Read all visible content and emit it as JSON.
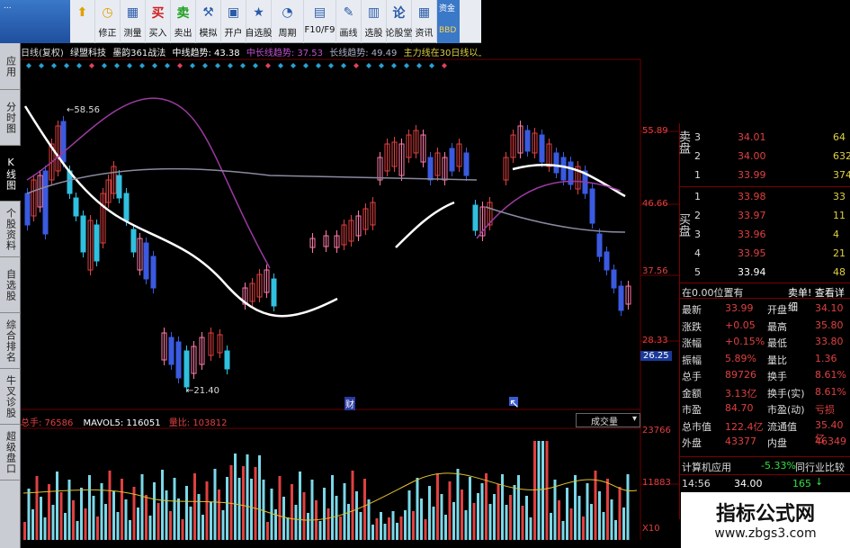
{
  "toolbar": {
    "logo_text": "...",
    "buttons": [
      {
        "label": "",
        "icon": "up-arrow-icon"
      },
      {
        "label": "修正",
        "icon": "clock-icon"
      },
      {
        "label": "测量",
        "icon": "gauge-icon"
      },
      {
        "label": "买入",
        "icon": "buy-icon"
      },
      {
        "label": "卖出",
        "icon": "sell-icon"
      },
      {
        "label": "模拟",
        "icon": "hammer-icon"
      },
      {
        "label": "开户",
        "icon": "lock-icon"
      },
      {
        "label": "自选股",
        "icon": "star-icon"
      },
      {
        "label": "周期",
        "icon": "clock-cycle-icon"
      },
      {
        "label": "F10/F9",
        "icon": "f10-icon"
      },
      {
        "label": "画线",
        "icon": "pencil-icon"
      },
      {
        "label": "选股",
        "icon": "select-icon"
      },
      {
        "label": "论股堂",
        "icon": "chat-icon"
      },
      {
        "label": "资讯",
        "icon": "news-icon"
      }
    ],
    "end_label_1": "资金",
    "end_label_2": "BBD"
  },
  "side_tabs": [
    "应用",
    "分时图",
    "K线图",
    "个股资料",
    "自选股",
    "综合排名",
    "牛叉诊股",
    "超级盘口"
  ],
  "side_tab_active": 2,
  "chart_header": {
    "period": "日线(复权)",
    "stock": "绿盟科技",
    "indicator": "墨韵361战法",
    "mid_label": "中线趋势: 43.38",
    "midlong_label": "中长线趋势: 37.53",
    "long_label": "长线趋势: 49.49",
    "note": "主力线在30日线以上显示"
  },
  "price_axis": [
    "55.89",
    "46.66",
    "37.56",
    "28.33",
    "26.25",
    "23766",
    "11883",
    "X10"
  ],
  "annotations": {
    "high": "58.56",
    "low": "21.40",
    "marker": "财"
  },
  "volume_header": {
    "total": "总手: 76586",
    "mavol": "MAVOL5: 116051",
    "ratio": "量比: 103812",
    "select": "成交量"
  },
  "order_book": {
    "sell": [
      {
        "level": "3",
        "price": "34.01",
        "vol": "64"
      },
      {
        "level": "2",
        "price": "34.00",
        "vol": "632"
      },
      {
        "level": "1",
        "price": "33.99",
        "vol": "374"
      }
    ],
    "buy": [
      {
        "level": "1",
        "price": "33.98",
        "vol": "33"
      },
      {
        "level": "2",
        "price": "33.97",
        "vol": "11"
      },
      {
        "level": "3",
        "price": "33.96",
        "vol": "4"
      },
      {
        "level": "4",
        "price": "33.95",
        "vol": "21"
      },
      {
        "level": "5",
        "price": "33.94",
        "vol": "48"
      }
    ],
    "sell_side_label": "卖盘",
    "buy_side_label": "买盘"
  },
  "quote": {
    "status": "在0.00位置有",
    "detail": "卖单! 查看详细",
    "rows": [
      {
        "l1": "最新",
        "v1": "33.99",
        "l2": "开盘",
        "v2": "34.10"
      },
      {
        "l1": "涨跌",
        "v1": "+0.05",
        "l2": "最高",
        "v2": "35.80"
      },
      {
        "l1": "涨幅",
        "v1": "+0.15%",
        "l2": "最低",
        "v2": "33.80"
      },
      {
        "l1": "振幅",
        "v1": "5.89%",
        "l2": "量比",
        "v2": "1.36"
      },
      {
        "l1": "总手",
        "v1": "89726",
        "l2": "换手",
        "v2": "8.61%"
      },
      {
        "l1": "金额",
        "v1": "3.13亿",
        "l2": "换手(实)",
        "v2": "8.61%"
      },
      {
        "l1": "市盈",
        "v1": "84.70",
        "l2": "市盈(动)",
        "v2": "亏损"
      },
      {
        "l1": "总市值",
        "v1": "122.4亿",
        "l2": "流通值",
        "v2": "35.40亿"
      },
      {
        "l1": "外盘",
        "v1": "43377",
        "l2": "内盘",
        "v2": "46349"
      }
    ],
    "sector": "计算机应用",
    "sector_change": "-5.33%",
    "sector_compare": "同行业比较",
    "tick_time": "14:56",
    "tick_price": "34.00",
    "tick_vol": "165"
  },
  "watermark": {
    "title": "指标公式网",
    "url": "www.zbgs3.com"
  },
  "colors": {
    "up": "#e03030",
    "down": "#30c0e0",
    "white": "#ffffff",
    "purple": "#9a3aa0",
    "grey": "#8a8aa0",
    "yellow": "#e0c030"
  }
}
